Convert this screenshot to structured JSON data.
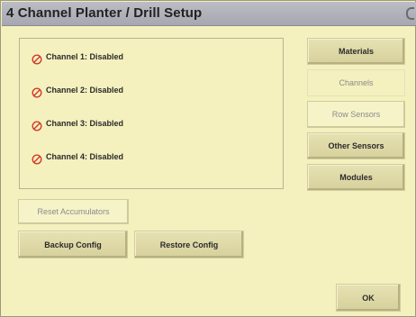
{
  "window": {
    "title": "4 Channel Planter / Drill Setup"
  },
  "channels": [
    {
      "label": "Channel 1: Disabled",
      "icon": "disabled-icon"
    },
    {
      "label": "Channel 2: Disabled",
      "icon": "disabled-icon"
    },
    {
      "label": "Channel 3: Disabled",
      "icon": "disabled-icon"
    },
    {
      "label": "Channel 4: Disabled",
      "icon": "disabled-icon"
    }
  ],
  "side_nav": {
    "materials": "Materials",
    "channels": "Channels",
    "row_sensors": "Row Sensors",
    "other_sensors": "Other Sensors",
    "modules": "Modules"
  },
  "actions": {
    "reset_accumulators": "Reset Accumulators",
    "backup_config": "Backup Config",
    "restore_config": "Restore Config",
    "ok": "OK"
  },
  "colors": {
    "background": "#f4f1bf",
    "titlebar": "#a6a7b0",
    "button": "#d6d09c",
    "disabled_icon": "#d23a2a"
  }
}
